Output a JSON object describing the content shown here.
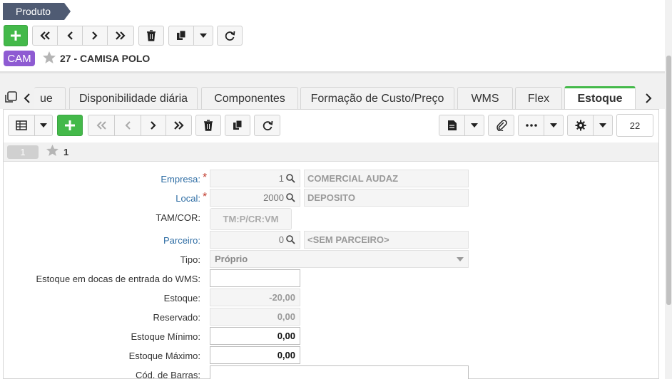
{
  "breadcrumb": {
    "label": "Produto"
  },
  "product": {
    "badge": "CAM",
    "title": "27 - CAMISA POLO"
  },
  "tabs": [
    {
      "label": "ue"
    },
    {
      "label": "Disponibilidade diária"
    },
    {
      "label": "Componentes"
    },
    {
      "label": "Formação de Custo/Preço"
    },
    {
      "label": "WMS"
    },
    {
      "label": "Flex"
    },
    {
      "label": "Estoque"
    }
  ],
  "grid": {
    "record_count": "22",
    "record_number": "1",
    "record_id": "1"
  },
  "form": {
    "empresa": {
      "label": "Empresa:",
      "code": "1",
      "desc": "COMERCIAL AUDAZ"
    },
    "local": {
      "label": "Local:",
      "code": "2000",
      "desc": "DEPOSITO"
    },
    "tamcor": {
      "label": "TAM/COR:",
      "value": "TM:P/CR:VM"
    },
    "parceiro": {
      "label": "Parceiro:",
      "code": "0",
      "desc": "<SEM PARCEIRO>"
    },
    "tipo": {
      "label": "Tipo:",
      "value": "Próprio"
    },
    "estoque_docas": {
      "label": "Estoque em docas de entrada do WMS:",
      "value": ""
    },
    "estoque": {
      "label": "Estoque:",
      "value": "-20,00"
    },
    "reservado": {
      "label": "Reservado:",
      "value": "0,00"
    },
    "estoque_minimo": {
      "label": "Estoque Mínimo:",
      "value": "0,00"
    },
    "estoque_maximo": {
      "label": "Estoque Máximo:",
      "value": "0,00"
    },
    "cod_barras": {
      "label": "Cód. de Barras:",
      "value": ""
    }
  },
  "colors": {
    "accent": "#44b94a",
    "badge": "#8e5bd2",
    "link": "#2e6da4",
    "breadcrumb": "#4f5b73"
  },
  "icons": [
    "plus-icon",
    "first-icon",
    "prev-icon",
    "next-icon",
    "last-icon",
    "trash-icon",
    "copy-icon",
    "caret-down-icon",
    "refresh-icon",
    "star-icon",
    "windows-icon",
    "grid-icon",
    "report-icon",
    "paperclip-icon",
    "more-icon",
    "gear-icon",
    "search-icon"
  ]
}
